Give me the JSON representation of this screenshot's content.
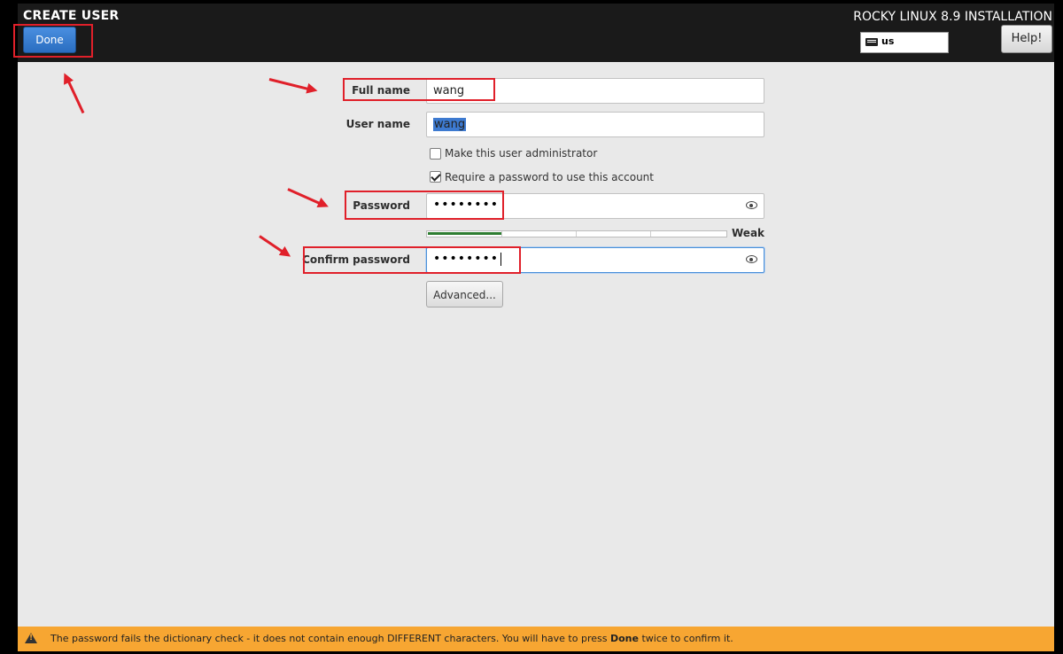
{
  "header": {
    "title": "CREATE USER",
    "done_label": "Done",
    "product": "ROCKY LINUX 8.9 INSTALLATION",
    "keyboard_layout": "us",
    "help_label": "Help!"
  },
  "form": {
    "full_name_label": "Full name",
    "full_name_value": "wang",
    "user_name_label": "User name",
    "user_name_value": "wang",
    "admin_checkbox_label": "Make this user administrator",
    "admin_checked": false,
    "require_password_label": "Require a password to use this account",
    "require_password_checked": true,
    "password_label": "Password",
    "password_masked": "••••••••",
    "confirm_label": "Confirm password",
    "confirm_masked": "••••••••",
    "strength_label": "Weak",
    "strength_level": 0.25,
    "advanced_label": "Advanced..."
  },
  "status_bar": {
    "text_before": "The password fails the dictionary check - it does not contain enough DIFFERENT characters. You will have to press",
    "emphasis": "Done",
    "text_after": "twice to confirm it."
  },
  "colors": {
    "header_bg": "#1a1a1a",
    "content_bg": "#e9e9e9",
    "accent_blue": "#2a6dc0",
    "warning_bar": "#f7a632",
    "strength_fill": "#2e7d32",
    "annotation_red": "#e0202a"
  },
  "icons": [
    "keyboard-icon",
    "eye-icon",
    "warning-icon",
    "checkmark-icon"
  ]
}
